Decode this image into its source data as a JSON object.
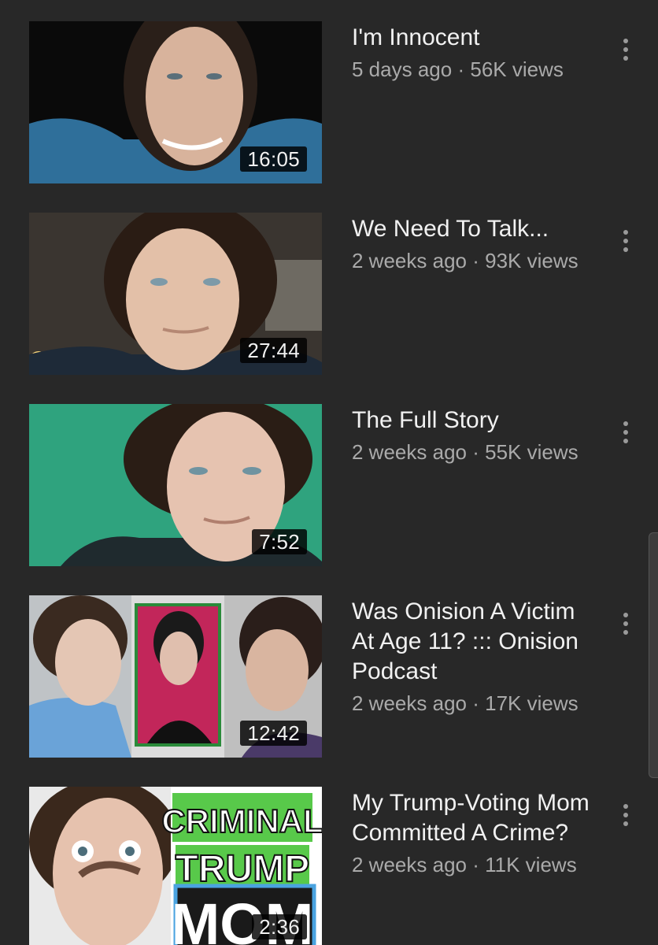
{
  "videos": [
    {
      "title": "I'm Innocent",
      "age": "5 days ago",
      "views": "56K views",
      "separator": "·",
      "duration": "16:05"
    },
    {
      "title": "We Need To Talk...",
      "age": "2 weeks ago",
      "views": "93K views",
      "separator": "·",
      "duration": "27:44"
    },
    {
      "title": "The Full Story",
      "age": "2 weeks ago",
      "views": "55K views",
      "separator": "·",
      "duration": "7:52"
    },
    {
      "title": "Was Onision A Victim At Age 11? ::: Onision Podcast",
      "age": "2 weeks ago",
      "views": "17K views",
      "separator": "·",
      "duration": "12:42"
    },
    {
      "title": "My Trump-Voting Mom Committed A Crime?",
      "age": "2 weeks ago",
      "views": "11K views",
      "separator": "·",
      "duration": "2:36",
      "thumb_text": [
        "CRIMINAL",
        "TRUMP",
        "MOM"
      ]
    }
  ],
  "icons": {
    "menu": "more-vertical-icon"
  },
  "colors": {
    "background": "#282828",
    "title": "#f1f1f1",
    "meta": "#aaaaaa"
  }
}
